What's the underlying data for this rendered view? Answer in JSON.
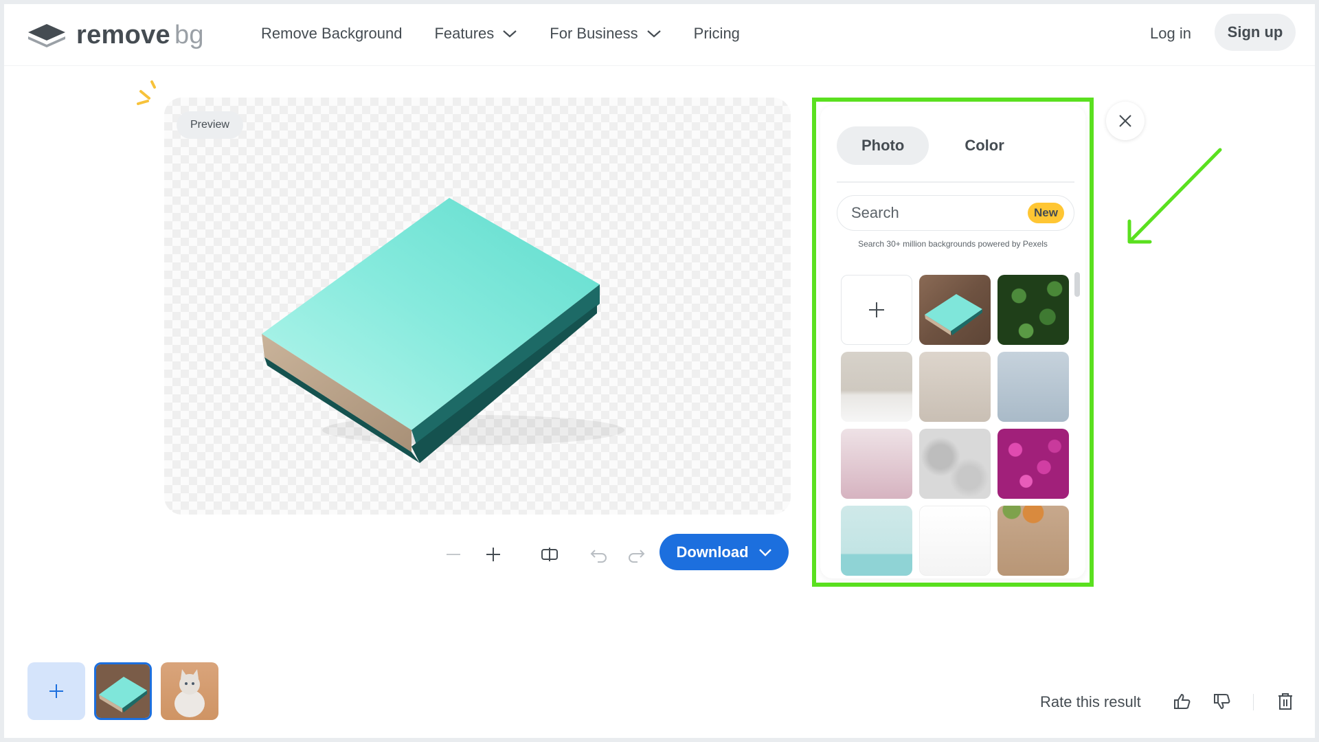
{
  "header": {
    "logo_word1": "remove",
    "logo_word2": "bg",
    "nav": [
      {
        "label": "Remove Background"
      },
      {
        "label": "Features"
      },
      {
        "label": "For Business"
      },
      {
        "label": "Pricing"
      }
    ],
    "login_label": "Log in",
    "signup_label": "Sign up"
  },
  "preview": {
    "badge_label": "Preview",
    "subject": "teal hardcover book",
    "background": "transparent-checkerboard"
  },
  "toolbar": {
    "zoom_out_icon": "minus-icon",
    "zoom_in_icon": "plus-icon",
    "compare_icon": "compare-icon",
    "undo_icon": "undo-icon",
    "redo_icon": "redo-icon",
    "download_label": "Download"
  },
  "panel": {
    "tabs": [
      {
        "label": "Photo",
        "active": true
      },
      {
        "label": "Color",
        "active": false
      }
    ],
    "search_placeholder": "Search",
    "new_badge": "New",
    "powered_text": "Search 30+ million backgrounds powered by Pexels",
    "backgrounds": [
      "upload",
      "wood-book",
      "green-leaves",
      "beige-wall",
      "taupe-gradient",
      "blue-gray",
      "pink-gradient",
      "gray-marble",
      "magenta-flowers",
      "mint-shelf",
      "white-desk",
      "wood-autumn"
    ]
  },
  "bottom": {
    "rate_label": "Rate this result",
    "images": [
      "book",
      "cat"
    ]
  },
  "colors": {
    "accent": "#1c6fde",
    "highlight": "#5ae01f",
    "badge": "#ffc633"
  }
}
